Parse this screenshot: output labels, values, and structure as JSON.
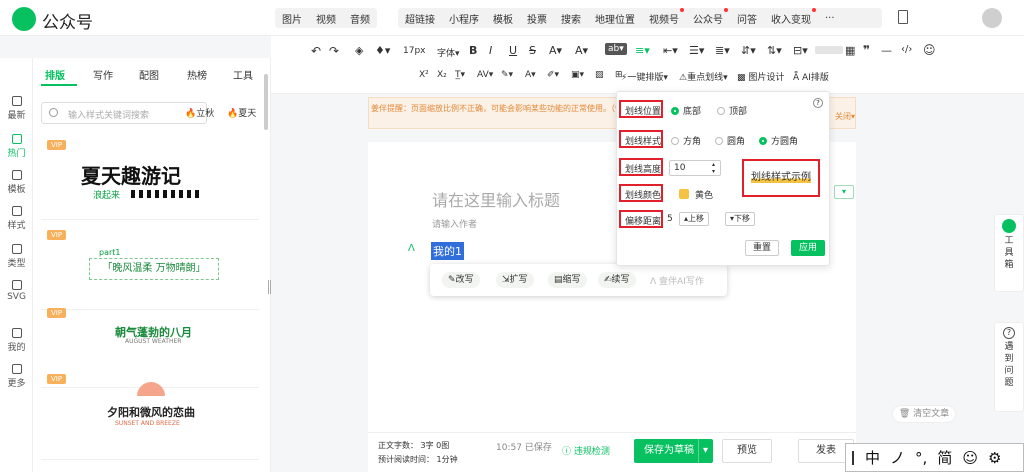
{
  "app": {
    "name": "公众号"
  },
  "topmenu": {
    "group1": [
      "图片",
      "视频",
      "音频"
    ],
    "group2": [
      "超链接",
      "小程序",
      "模板",
      "投票",
      "搜索",
      "地理位置",
      "视频号",
      "公众号",
      "问答",
      "收入变现",
      "···"
    ]
  },
  "panel": {
    "tabs": [
      "排版",
      "写作",
      "配图",
      "热榜",
      "工具"
    ],
    "search_placeholder": "输入样式关键词搜索",
    "tags": [
      "立秋",
      "夏天"
    ],
    "vip_label": "VIP",
    "cards": [
      {
        "title": "夏天趣游记",
        "sub": "浪起来"
      },
      {
        "title": "part1",
        "sub": "「晚风温柔 万物晴朗」"
      },
      {
        "title": "朝气蓬勃的八月",
        "sub": "AUGUST WEATHER"
      },
      {
        "title": "夕阳和微风的恋曲",
        "sub": "SUNSET AND BREEZE"
      }
    ]
  },
  "leftnav": [
    "最新",
    "热门",
    "模板",
    "样式",
    "类型",
    "SVG",
    "我的",
    "更多"
  ],
  "toolbar": {
    "font_size": "17px",
    "font_label": "字体",
    "row2_labels": [
      "一键排版",
      "重点划线",
      "图片设计",
      "AI排版"
    ]
  },
  "notice": {
    "text": "姜伴提醒：页面缩放比例不正确，可能会影响某些功能的正常使用。（恢复正常比例：Ctrl + \"0\"）",
    "close": "关闭"
  },
  "editor": {
    "title_placeholder": "请在这里输入标题",
    "author_placeholder": "请输入作者",
    "selected_text": "我的1",
    "ai_actions": [
      "改写",
      "扩写",
      "缩写",
      "续写"
    ],
    "ai_disabled": "壹伴AI写作"
  },
  "underline_popup": {
    "position_label": "划线位置",
    "position_options": [
      "底部",
      "顶部"
    ],
    "style_label": "划线样式",
    "style_options": [
      "方角",
      "圆角",
      "方圆角"
    ],
    "height_label": "划线高度",
    "height_value": "10",
    "color_label": "划线颜色",
    "color_name": "黄色",
    "offset_label": "偏移距离",
    "offset_value": "5",
    "up": "上移",
    "down": "下移",
    "sample": "划线样式示例",
    "reset": "重置",
    "apply": "应用"
  },
  "status": {
    "word_count_label": "正文字数：",
    "word_count": "3字 0图",
    "read_time_label": "预计阅读时间：",
    "read_time": "1分钟",
    "saved_time": "10:57",
    "saved_label": "已保存",
    "compliance": "违规检测"
  },
  "actions": {
    "save_draft": "保存为草稿",
    "preview": "预览",
    "publish": "发表",
    "clear": "清空文章"
  },
  "side": {
    "toolbox": [
      "工",
      "具",
      "箱"
    ],
    "help": [
      "遇",
      "到",
      "问",
      "题"
    ]
  },
  "ime": [
    "中",
    "ノ",
    "°,",
    "简",
    "☺",
    "⚙"
  ]
}
